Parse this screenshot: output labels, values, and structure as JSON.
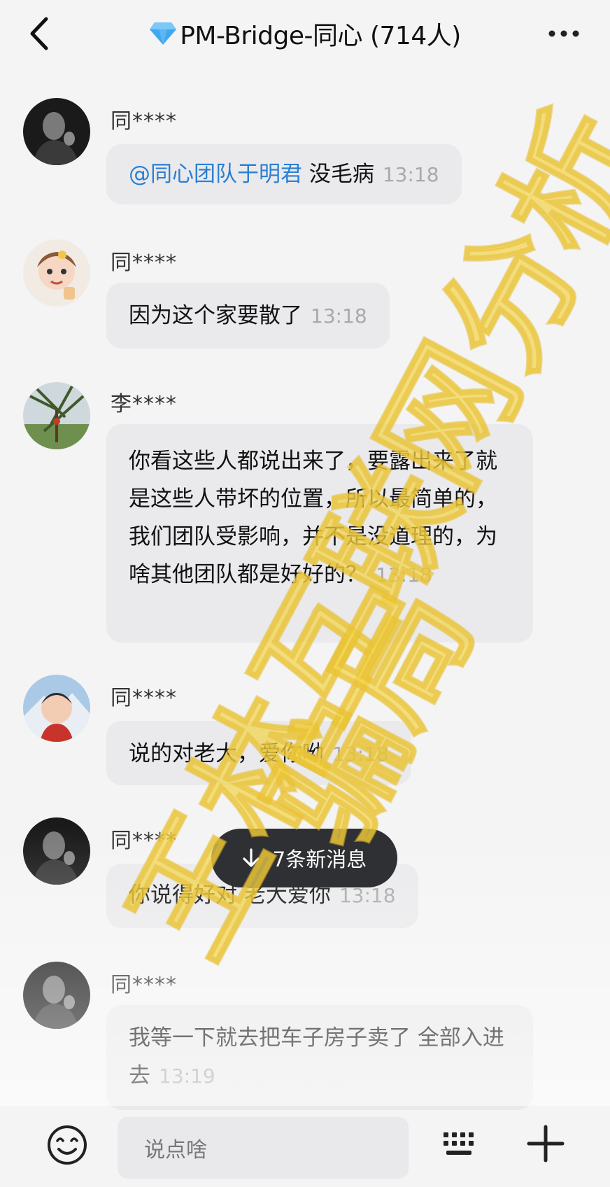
{
  "header": {
    "title": "PM-Bridge-同心 (714人)",
    "back_icon": "chevron-left-icon",
    "more_icon": "more-horizontal-icon",
    "gem_icon": "diamond-icon"
  },
  "messages": [
    {
      "sender": "同****",
      "mention": "@同心团队于明君",
      "text": " 没毛病",
      "time": "13:18"
    },
    {
      "sender": "同****",
      "text": "因为这个家要散了",
      "time": "13:18"
    },
    {
      "sender": "李****",
      "text": "你看这些人都说出来了，要露出来了就是这些人带坏的位置，所以最简单的，我们团队受影响，并不是没道理的，为啥其他团队都是好好的？",
      "time": "13:18"
    },
    {
      "sender": "同****",
      "text": "说的对老大，爱你呦",
      "time": "13:18"
    },
    {
      "sender": "同****",
      "text": "你说得好对 老大爱你",
      "time": "13:18"
    },
    {
      "sender": "同****",
      "text": "我等一下就去把车子房子卖了 全部入进去",
      "time": "13:19"
    }
  ],
  "new_messages": {
    "label": "7条新消息",
    "icon": "arrow-down-icon"
  },
  "input": {
    "placeholder": "说点啥"
  },
  "toolbar": {
    "emoji_icon": "emoji-icon",
    "keyboard_icon": "keyboard-icon",
    "plus_icon": "plus-icon"
  },
  "watermark": {
    "line1": "王林互联网分析",
    "line2": "骗局"
  },
  "colors": {
    "mention": "#2a7fd4",
    "bubble": "#eaeaec",
    "watermark": "#f2d24a",
    "pill": "#2f3033"
  }
}
